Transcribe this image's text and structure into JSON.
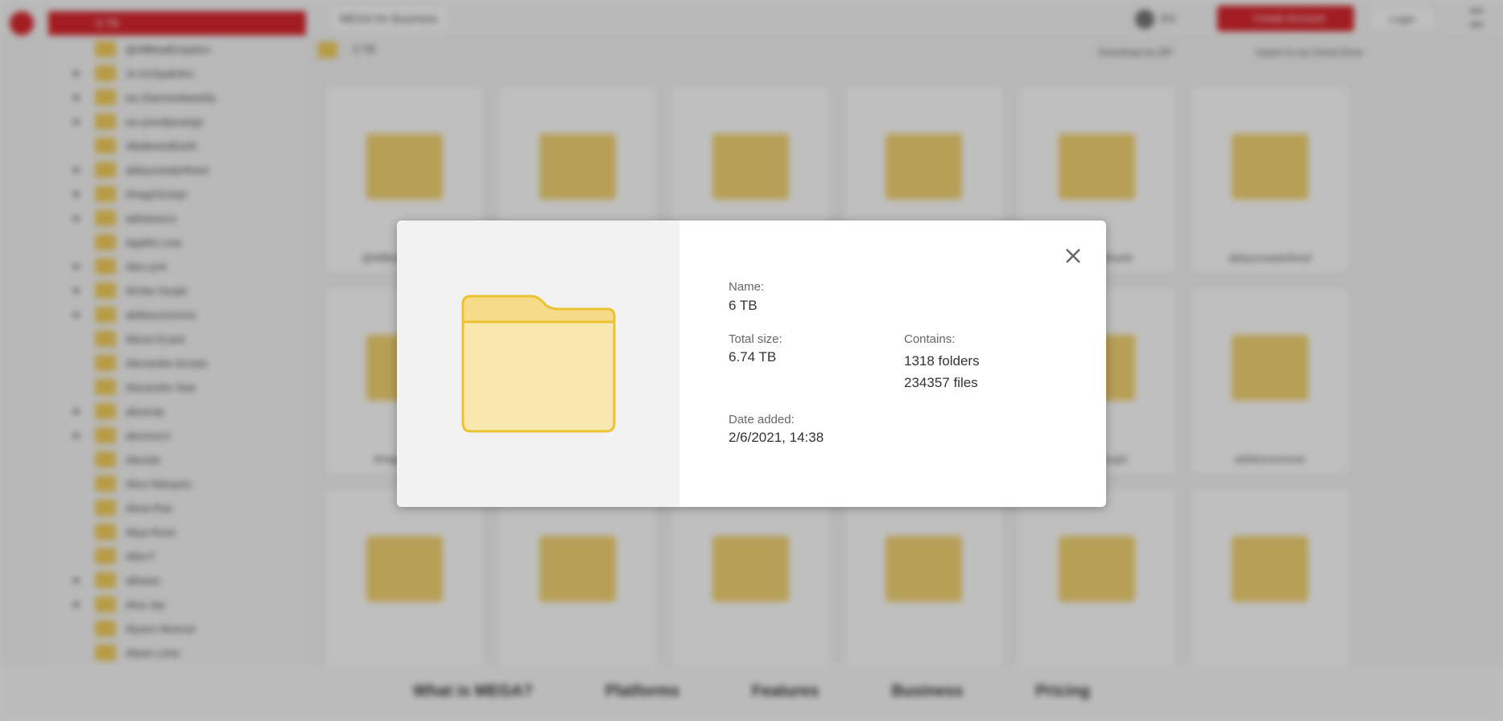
{
  "topbar": {
    "breadcrumb": "6 TB",
    "business": "MEGA for Business",
    "lang": "EN",
    "create": "Create Account",
    "login": "Login"
  },
  "path": "6 TB",
  "actions": {
    "download": "Download as ZIP",
    "import": "Import to my Cloud Drive"
  },
  "sidebar": [
    "@AllBeatEmptiers",
    "Jn.GzSpalrdcs",
    "wu Diamondweekly",
    "wu pravitjavangs",
    "48a8eeedEarth",
    "abbyunwaterfined",
    "Ahag2314ojn",
    "adrianescs",
    "Agathe Lina",
    "Alex-yn4",
    "AGAw Huujin",
    "alefiesconnone",
    "Alexei Ecard",
    "Alexandre Acosta",
    "Alexandre Swe",
    "alexevip",
    "alexmurci",
    "Alexote",
    "Alice Marques",
    "Alicia Rae",
    "Aliya Rose",
    "AllenT",
    "allnews",
    "Alva Jay",
    "Alyson Monroe",
    "Alwen Lime"
  ],
  "tiles": [
    "@AllBeatEmptiers",
    "",
    "",
    "",
    "48a8eeedEarth",
    "abbyunwaterfined",
    "Ahag2314ojn",
    "",
    "",
    "",
    "AGAw Huujin",
    "alefiesconnone",
    "",
    "",
    "",
    "",
    "",
    ""
  ],
  "footer": [
    "What is MEGA?",
    "Platforms",
    "Features",
    "Business",
    "Pricing"
  ],
  "modal": {
    "name_label": "Name:",
    "name": "6 TB",
    "size_label": "Total size:",
    "size": "6.74 TB",
    "contains_label": "Contains:",
    "folders": "1318 folders",
    "files": "234357 files",
    "date_label": "Date added:",
    "date": "2/6/2021, 14:38"
  },
  "colors": {
    "accent": "#d9272e",
    "folder": "#f9e7b0"
  }
}
